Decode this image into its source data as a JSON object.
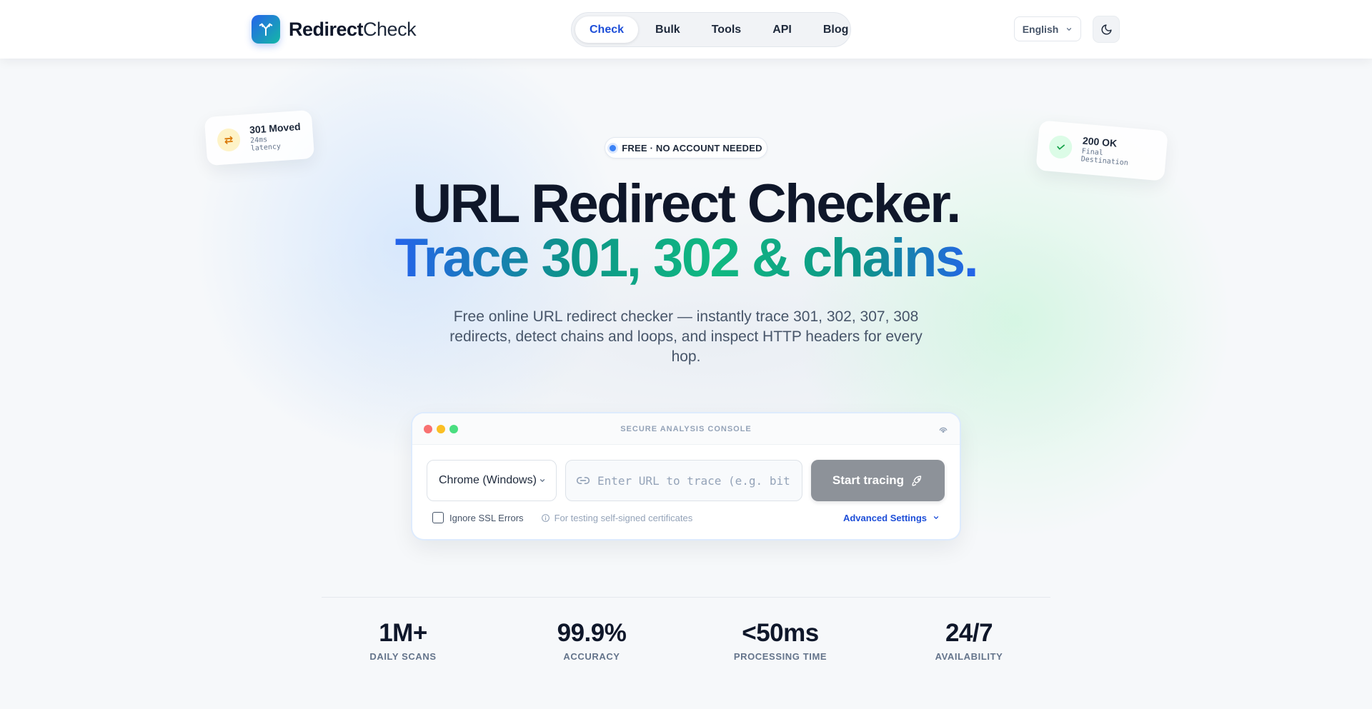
{
  "header": {
    "logo_bold": "Redirect",
    "logo_normal": "Check",
    "nav": [
      "Check",
      "Bulk",
      "Tools",
      "API",
      "Blog"
    ],
    "active_nav": "Check",
    "language": "English",
    "theme_icon": "moon-icon"
  },
  "floating_cards": {
    "left": {
      "title": "301 Moved",
      "sub": "24ms latency",
      "icon": "swap-arrows-icon"
    },
    "right": {
      "title": "200 OK",
      "sub": "Final Destination",
      "icon": "check-icon"
    }
  },
  "hero": {
    "badge": "FREE · NO ACCOUNT NEEDED",
    "title_line1": "URL Redirect Checker.",
    "title_line2": "Trace 301, 302 & chains.",
    "subtitle": "Free online URL redirect checker — instantly trace 301, 302, 307, 308 redirects, detect chains and loops, and inspect HTTP headers for every hop."
  },
  "console": {
    "title": "SECURE ANALYSIS CONSOLE",
    "user_agent": "Chrome (Windows)",
    "url_placeholder": "Enter URL to trace (e.g. bit.ly/...)",
    "url_value": "",
    "start_label": "Start tracing",
    "ssl_label": "Ignore SSL Errors",
    "ssl_checked": false,
    "hint": "For testing self-signed certificates",
    "advanced_label": "Advanced Settings"
  },
  "stats": [
    {
      "value": "1M+",
      "label": "DAILY SCANS"
    },
    {
      "value": "99.9%",
      "label": "ACCURACY"
    },
    {
      "value": "<50ms",
      "label": "PROCESSING TIME"
    },
    {
      "value": "24/7",
      "label": "AVAILABILITY"
    }
  ],
  "colors": {
    "accent": "#1d4ed8",
    "gradient_start": "#2563eb",
    "gradient_mid": "#10b981",
    "button_disabled": "#8d9299"
  }
}
